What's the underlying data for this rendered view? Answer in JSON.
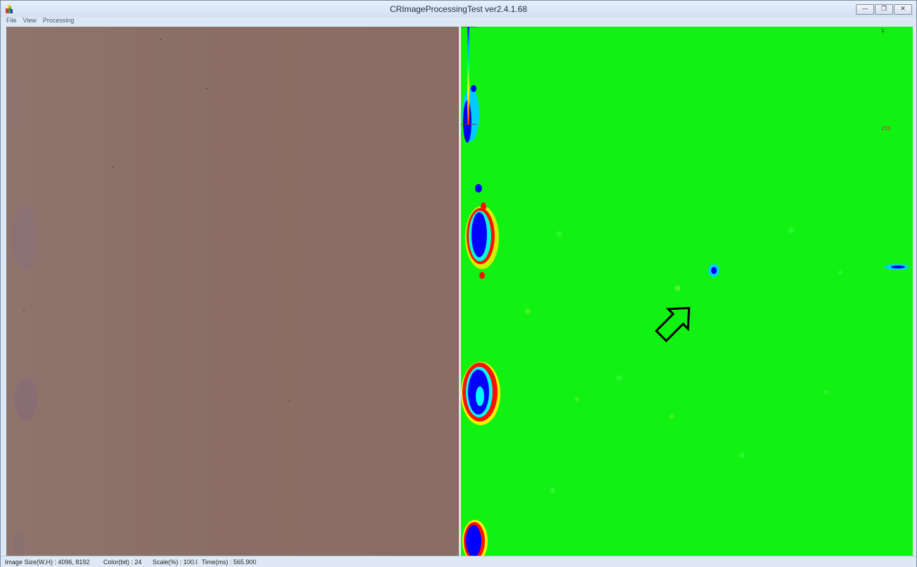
{
  "window": {
    "title": "CRImageProcessingTest ver2.4.1.68",
    "minimize_label": "—",
    "restore_label": "❐",
    "close_label": "✕"
  },
  "menu": [
    "File",
    "View",
    "Processing"
  ],
  "colorscale": {
    "max_label": "1",
    "min_label": "255",
    "colors": [
      "#1a1aff",
      "#00aaff",
      "#00ff66",
      "#ffff00",
      "#ff8800",
      "#ff1a00"
    ]
  },
  "status": {
    "image_size": "Image Size(W,H) : 4096, 8192",
    "color_bit": "Color(bit) : 24",
    "scale": "Scale(%) : 100.0",
    "time": "Time(ms) : 565.900"
  },
  "icons": {
    "app": "app-icon",
    "arrow": "arrow-cursor-icon"
  }
}
